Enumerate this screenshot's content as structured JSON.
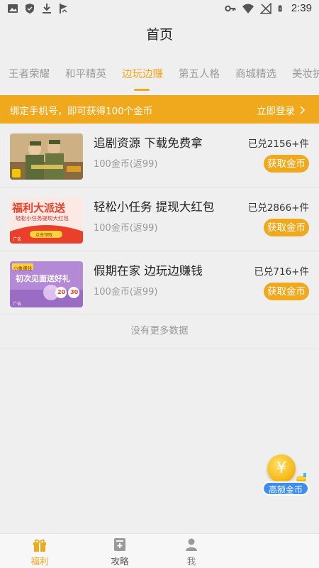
{
  "status_bar": {
    "time": "2:39",
    "left_icons": [
      "image-icon",
      "shield-icon",
      "download-icon",
      "flag-icon"
    ],
    "right_icons": [
      "key-icon",
      "wifi-icon",
      "no-signal-icon",
      "battery-icon"
    ]
  },
  "header": {
    "title": "首页"
  },
  "tabs": [
    {
      "label": "王者荣耀",
      "active": false
    },
    {
      "label": "和平精英",
      "active": false
    },
    {
      "label": "边玩边赚",
      "active": true
    },
    {
      "label": "第五人格",
      "active": false
    },
    {
      "label": "商城精选",
      "active": false
    },
    {
      "label": "美妆护",
      "active": false
    }
  ],
  "banner": {
    "text": "绑定手机号，即可获得100个金币",
    "action": "立即登录"
  },
  "items": [
    {
      "title": "追剧资源 下载免费拿",
      "subtitle": "100金币(返99)",
      "count": "已兑2156+件",
      "button": "获取金币"
    },
    {
      "title": "轻松小任务 提现大红包",
      "subtitle": "100金币(返99)",
      "count": "已兑2866+件",
      "button": "获取金币",
      "thumb_text": {
        "main": "福利大派送",
        "sub": "轻松小任务提现大红包",
        "btn": "点击领取",
        "tag": "广告"
      }
    },
    {
      "title": "假期在家 边玩边赚钱",
      "subtitle": "100金币(返99)",
      "count": "已兑716+件",
      "button": "获取金币",
      "thumb_text": {
        "badge": "小象赚钱",
        "main": "初次见面送好礼",
        "c1": "20",
        "c2": "30",
        "tag": "广告"
      }
    }
  ],
  "no_more": "没有更多数据",
  "float_button": {
    "symbol": "¥",
    "label": "高额金币"
  },
  "bottom_nav": [
    {
      "label": "福利",
      "icon": "gift-icon",
      "active": true
    },
    {
      "label": "攻略",
      "icon": "guide-icon",
      "active": false
    },
    {
      "label": "我",
      "icon": "user-icon",
      "active": false
    }
  ],
  "colors": {
    "accent": "#f0a81d",
    "background": "#efefef",
    "coin_label": "#3d8ef0"
  }
}
